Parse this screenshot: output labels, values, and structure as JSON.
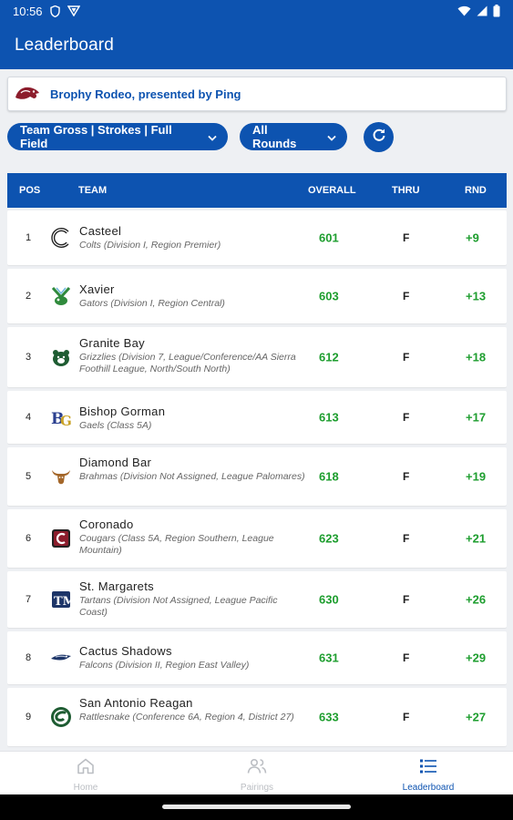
{
  "status_bar": {
    "time": "10:56",
    "icons": [
      "vpn-shield-icon",
      "play-protect-icon",
      "wifi-icon",
      "signal-icon",
      "battery-icon"
    ]
  },
  "app_bar": {
    "title": "Leaderboard"
  },
  "event": {
    "name": "Brophy Rodeo, presented by Ping",
    "logo_icon": "broncos-logo-icon"
  },
  "filters": {
    "field_filter": "Team Gross | Strokes | Full Field",
    "rounds_filter": "All Rounds",
    "refresh_icon": "refresh-icon"
  },
  "table": {
    "headers": {
      "pos": "POS",
      "team": "TEAM",
      "overall": "OVERALL",
      "thru": "THRU",
      "rnd": "RND"
    },
    "rows": [
      {
        "pos": "1",
        "name": "Casteel",
        "sub": "Colts (Division I, Region Premier)",
        "overall": "601",
        "thru": "F",
        "rnd": "+9",
        "logo": "casteel-logo-icon"
      },
      {
        "pos": "2",
        "name": "Xavier",
        "sub": "Gators (Division I, Region Central)",
        "overall": "603",
        "thru": "F",
        "rnd": "+13",
        "logo": "xavier-logo-icon"
      },
      {
        "pos": "3",
        "name": "Granite Bay",
        "sub": "Grizzlies (Division 7, League/Conference/AA Sierra Foothill League, North/South North)",
        "overall": "612",
        "thru": "F",
        "rnd": "+18",
        "logo": "granite-bay-logo-icon"
      },
      {
        "pos": "4",
        "name": "Bishop Gorman",
        "sub": "Gaels (Class 5A)",
        "overall": "613",
        "thru": "F",
        "rnd": "+17",
        "logo": "bishop-gorman-logo-icon"
      },
      {
        "pos": "5",
        "name": "Diamond Bar",
        "sub": "Brahmas (Division Not Assigned, League Palomares)",
        "overall": "618",
        "thru": "F",
        "rnd": "+19",
        "logo": "diamond-bar-logo-icon"
      },
      {
        "pos": "6",
        "name": "Coronado",
        "sub": "Cougars (Class 5A, Region Southern, League Mountain)",
        "overall": "623",
        "thru": "F",
        "rnd": "+21",
        "logo": "coronado-logo-icon"
      },
      {
        "pos": "7",
        "name": "St. Margarets",
        "sub": "Tartans (Division Not Assigned, League Pacific Coast)",
        "overall": "630",
        "thru": "F",
        "rnd": "+26",
        "logo": "st-margarets-logo-icon"
      },
      {
        "pos": "8",
        "name": "Cactus Shadows",
        "sub": "Falcons (Division II, Region East Valley)",
        "overall": "631",
        "thru": "F",
        "rnd": "+29",
        "logo": "cactus-shadows-logo-icon"
      },
      {
        "pos": "9",
        "name": "San Antonio Reagan",
        "sub": "Rattlesnake (Conference 6A, Region 4, District 27)",
        "overall": "633",
        "thru": "F",
        "rnd": "+27",
        "logo": "san-antonio-reagan-logo-icon"
      }
    ]
  },
  "bottom_nav": {
    "items": [
      {
        "label": "Home",
        "icon": "home-icon",
        "active": false
      },
      {
        "label": "Pairings",
        "icon": "pairings-icon",
        "active": false
      },
      {
        "label": "Leaderboard",
        "icon": "leaderboard-icon",
        "active": true
      }
    ]
  },
  "colors": {
    "primary": "#0d53b0",
    "score_green": "#1e9e2f",
    "background": "#eef0f3"
  }
}
